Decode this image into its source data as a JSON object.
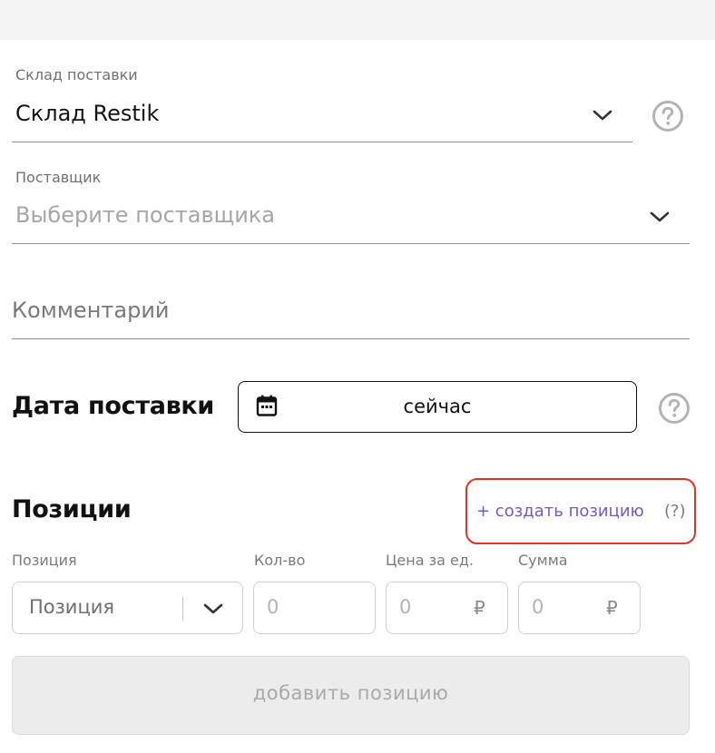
{
  "warehouse": {
    "label": "Склад поставки",
    "value": "Склад Restik"
  },
  "supplier": {
    "label": "Поставщик",
    "placeholder": "Выберите поставщика"
  },
  "comment": {
    "placeholder": "Комментарий"
  },
  "delivery_date": {
    "heading": "Дата поставки",
    "value": "сейчас"
  },
  "positions": {
    "heading": "Позиции",
    "create_link": "+ создать позицию",
    "create_help": "(?)",
    "columns": {
      "position": "Позиция",
      "qty": "Кол-во",
      "unit_price": "Цена за ед.",
      "sum": "Сумма"
    },
    "position_select_value": "Позиция",
    "qty_placeholder": "0",
    "price_placeholder": "0",
    "sum_placeholder": "0",
    "currency": "₽",
    "add_button": "добавить позицию"
  },
  "icons": {
    "chevron": "chevron-down-icon",
    "help": "help-circle-icon",
    "calendar": "calendar-icon"
  },
  "colors": {
    "link": "#6b5bd6",
    "highlight": "#e8311f"
  }
}
